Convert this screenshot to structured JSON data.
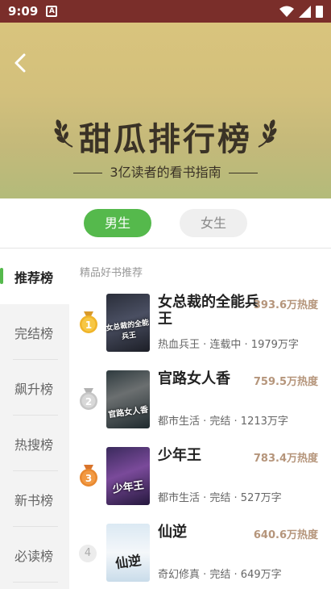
{
  "status_bar": {
    "time": "9:09"
  },
  "banner": {
    "title": "甜瓜排行榜",
    "subtitle": "3亿读者的看书指南"
  },
  "gender_tabs": [
    {
      "label": "男生",
      "active": true
    },
    {
      "label": "女生",
      "active": false
    }
  ],
  "sidebar": {
    "items": [
      {
        "label": "推荐榜",
        "active": true
      },
      {
        "label": "完结榜",
        "active": false
      },
      {
        "label": "飙升榜",
        "active": false
      },
      {
        "label": "热搜榜",
        "active": false
      },
      {
        "label": "新书榜",
        "active": false
      },
      {
        "label": "必读榜",
        "active": false
      }
    ]
  },
  "section_label": "精品好书推荐",
  "books": [
    {
      "rank": "1",
      "cover_text": "女总裁的全能兵王",
      "title": "女总裁的全能兵王",
      "heat": "393.6万热度",
      "meta": "热血兵王 · 连载中 · 1979万字"
    },
    {
      "rank": "2",
      "cover_text": "官路女人香",
      "title": "官路女人香",
      "heat": "759.5万热度",
      "meta": "都市生活 · 完结 · 1213万字"
    },
    {
      "rank": "3",
      "cover_text": "少年王",
      "title": "少年王",
      "heat": "783.4万热度",
      "meta": "都市生活 · 完结 · 527万字"
    },
    {
      "rank": "4",
      "cover_text": "仙逆",
      "title": "仙逆",
      "heat": "640.6万热度",
      "meta": "奇幻修真 · 完结 · 649万字"
    }
  ],
  "colors": {
    "accent": "#55b94c",
    "heat": "#b5957b",
    "status_bar": "#7a2e2a"
  },
  "icons": {
    "back": "back-arrow-icon",
    "laurel": "laurel-icon",
    "medal": "medal-icon"
  }
}
